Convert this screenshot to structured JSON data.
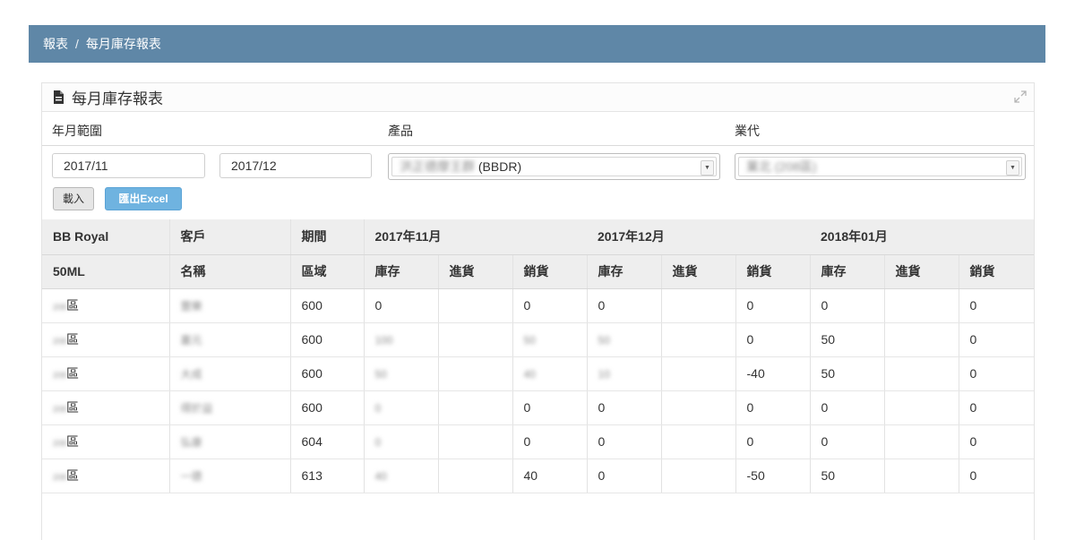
{
  "breadcrumb": {
    "parent": "報表",
    "separator": "/",
    "current": "每月庫存報表"
  },
  "panel": {
    "title": "每月庫存報表"
  },
  "filters": {
    "labels": {
      "date_range": "年月範圍",
      "product": "產品",
      "agent": "業代"
    },
    "date_from": "2017/11",
    "date_to": "2017/12",
    "product_name": "洪正德摩王群",
    "product_code": "(BBDR)",
    "agent_value": "業北 (208區)"
  },
  "buttons": {
    "load": "載入",
    "export": "匯出Excel"
  },
  "table": {
    "header1": [
      "BB Royal",
      "客戶",
      "期間",
      "2017年11月",
      "2017年12月",
      "2018年01月"
    ],
    "header2": [
      "50ML",
      "名稱",
      "區域",
      "庫存",
      "進貨",
      "銷貨",
      "庫存",
      "進貨",
      "銷貨",
      "庫存",
      "進貨",
      "銷貨"
    ],
    "rows": [
      {
        "region_code": "208",
        "region_suffix": "區",
        "customer": "豐樂",
        "area": "600",
        "cells": [
          "0",
          "",
          "0",
          "0",
          "",
          "0",
          "0",
          "",
          "0"
        ]
      },
      {
        "region_code": "208",
        "region_suffix": "區",
        "customer": "叢元",
        "area": "600",
        "cells": [
          "100",
          "",
          "50",
          "50",
          "",
          "0",
          "50",
          "",
          "0"
        ]
      },
      {
        "region_code": "208",
        "region_suffix": "區",
        "customer": "大成",
        "area": "600",
        "cells": [
          "50",
          "",
          "40",
          "10",
          "",
          "-40",
          "50",
          "",
          "0"
        ]
      },
      {
        "region_code": "208",
        "region_suffix": "區",
        "customer": "得於益",
        "area": "600",
        "cells": [
          "0",
          "",
          "0",
          "0",
          "",
          "0",
          "0",
          "",
          "0"
        ]
      },
      {
        "region_code": "208",
        "region_suffix": "區",
        "customer": "弘康",
        "area": "604",
        "cells": [
          "0",
          "",
          "0",
          "0",
          "",
          "0",
          "0",
          "",
          "0"
        ]
      },
      {
        "region_code": "208",
        "region_suffix": "區",
        "customer": "一德",
        "area": "613",
        "cells": [
          "40",
          "",
          "40",
          "0",
          "",
          "-50",
          "50",
          "",
          "0"
        ]
      }
    ],
    "blurred_cells": [
      [],
      [
        0,
        2,
        3
      ],
      [
        0,
        2,
        3
      ],
      [
        0
      ],
      [
        0
      ],
      [
        0
      ]
    ]
  },
  "icons": {
    "document": "file-text-icon",
    "expand": "expand-icon",
    "dropdown": "caret-down-icon"
  }
}
